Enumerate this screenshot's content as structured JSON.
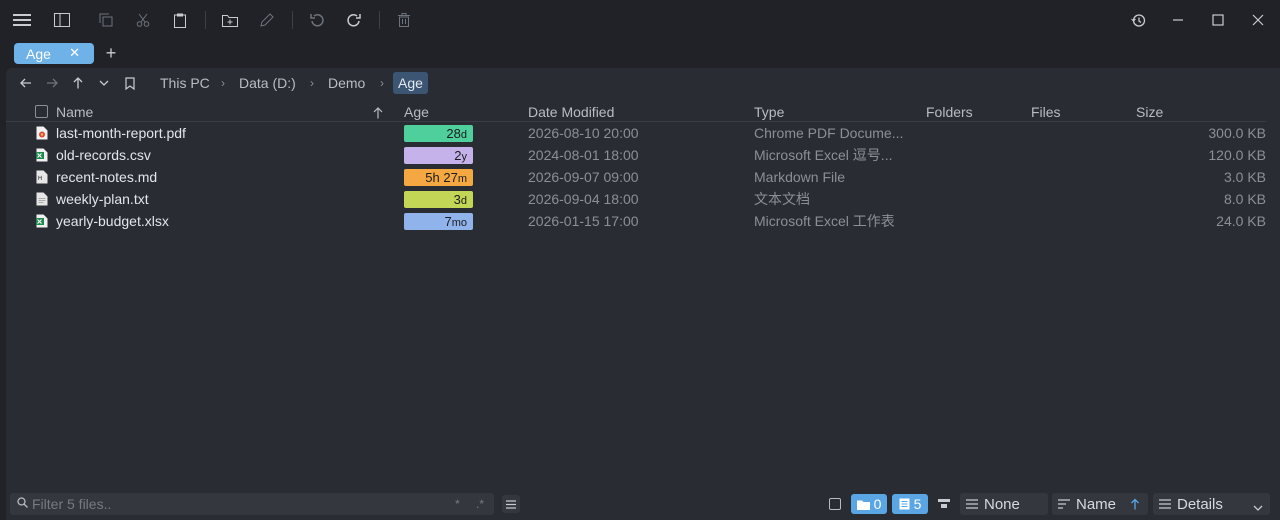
{
  "toolbar": {
    "icons": [
      "menu-icon",
      "sidebar-icon",
      "copy-icon",
      "cut-icon",
      "paste-icon",
      "new-folder-icon",
      "rename-icon",
      "undo-icon",
      "redo-icon",
      "delete-icon"
    ],
    "window_icons": [
      "history-icon",
      "minimize-icon",
      "maximize-icon",
      "close-icon"
    ]
  },
  "tabs": [
    {
      "label": "Age",
      "close": "✕"
    }
  ],
  "add_tab": "+",
  "breadcrumb": [
    "This PC",
    "Data (D:)",
    "Demo",
    "Age"
  ],
  "breadcrumb_sep": "›",
  "columns": {
    "name": "Name",
    "age": "Age",
    "date_modified": "Date Modified",
    "type": "Type",
    "folders": "Folders",
    "files": "Files",
    "size": "Size"
  },
  "files": [
    {
      "name": "last-month-report.pdf",
      "age_num": "28",
      "age_unit": "d",
      "age_color": "#4fcf9c",
      "date": "2026-08-10 20:00",
      "type": "Chrome PDF Docume...",
      "size": "300.0 KB",
      "icon": "pdf-icon"
    },
    {
      "name": "old-records.csv",
      "age_num": "2",
      "age_unit": "y",
      "age_color": "#c5b2ea",
      "date": "2024-08-01 18:00",
      "type": "Microsoft Excel 逗号...",
      "size": "120.0 KB",
      "icon": "excel-icon"
    },
    {
      "name": "recent-notes.md",
      "age_num": "5h 27",
      "age_unit": "m",
      "age_color": "#f5a742",
      "date": "2026-09-07 09:00",
      "type": "Markdown File",
      "size": "3.0 KB",
      "icon": "markdown-icon"
    },
    {
      "name": "weekly-plan.txt",
      "age_num": "3",
      "age_unit": "d",
      "age_color": "#c4d655",
      "date": "2026-09-04 18:00",
      "type": "文本文档",
      "size": "8.0 KB",
      "icon": "text-file-icon"
    },
    {
      "name": "yearly-budget.xlsx",
      "age_num": "7",
      "age_unit": "mo",
      "age_color": "#8fb3ea",
      "date": "2026-01-15 17:00",
      "type": "Microsoft Excel 工作表",
      "size": "24.0 KB",
      "icon": "excel-icon"
    }
  ],
  "status": {
    "filter_placeholder": "Filter 5 files..",
    "filter_opt_wildcard": "*",
    "filter_opt_regex": ".*",
    "folders_count": "0",
    "files_count": "5",
    "group_label": "None",
    "sort_label": "Name",
    "view_label": "Details"
  }
}
